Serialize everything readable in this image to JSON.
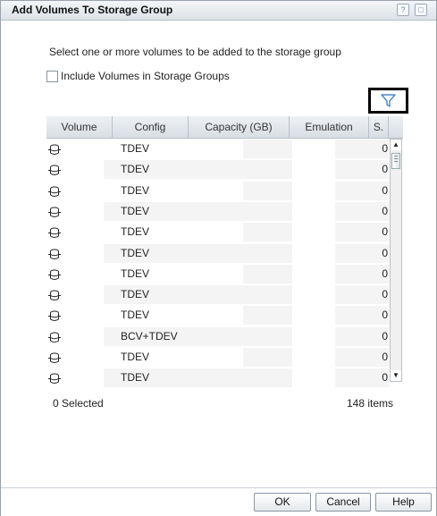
{
  "dialog": {
    "title": "Add Volumes To Storage Group",
    "help_glyph": "?",
    "maximize_glyph": "□"
  },
  "instructions": "Select one or more volumes to be added to the storage group",
  "include_checkbox": {
    "label": "Include Volumes in Storage Groups",
    "checked": false
  },
  "filter_icon": "filter-icon",
  "table": {
    "columns": [
      "Volume",
      "Config",
      "Capacity (GB)",
      "Emulation",
      "S."
    ],
    "rows": [
      {
        "config": "TDEV",
        "s": "0"
      },
      {
        "config": "TDEV",
        "s": "0"
      },
      {
        "config": "TDEV",
        "s": "0"
      },
      {
        "config": "TDEV",
        "s": "0"
      },
      {
        "config": "TDEV",
        "s": "0"
      },
      {
        "config": "TDEV",
        "s": "0"
      },
      {
        "config": "TDEV",
        "s": "0"
      },
      {
        "config": "TDEV",
        "s": "0"
      },
      {
        "config": "TDEV",
        "s": "0"
      },
      {
        "config": "BCV+TDEV",
        "s": "0"
      },
      {
        "config": "TDEV",
        "s": "0"
      },
      {
        "config": "TDEV",
        "s": "0"
      }
    ]
  },
  "status": {
    "selected": "0 Selected",
    "items": "148 items"
  },
  "buttons": {
    "ok": "OK",
    "cancel": "Cancel",
    "help": "Help"
  },
  "scrollbar": {
    "up": "▲",
    "down": "▼"
  }
}
